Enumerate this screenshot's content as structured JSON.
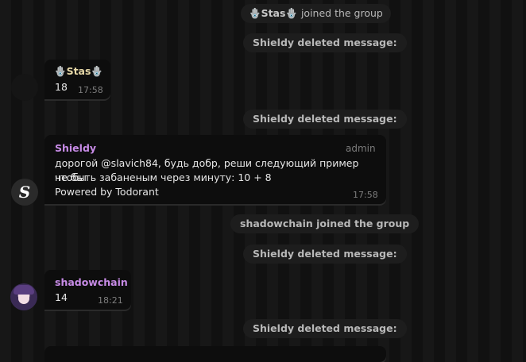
{
  "messages": {
    "service_1": {
      "sender": "🪬Stas🪬",
      "text": " joined the group"
    },
    "service_2": {
      "text": "Shieldy deleted message:"
    },
    "msg_stas": {
      "sender": "🪬Stas🪬",
      "body": "18",
      "time": "17:58"
    },
    "service_3": {
      "text": "Shieldy deleted message:"
    },
    "msg_shieldy": {
      "sender": "Shieldy",
      "role": "admin",
      "line1": "дорогой @slavich84, будь добр, реши следующий пример чтобы",
      "line2": "не быть забаненым через минуту: 10 + 8",
      "line3": "Powered by Todorant",
      "time": "17:58",
      "avatar_letter": "S"
    },
    "service_4": {
      "text": "shadowchain joined the group"
    },
    "service_5": {
      "text": "Shieldy deleted message:"
    },
    "msg_shadow": {
      "sender": "shadowchain",
      "body": "14",
      "time": "18:21"
    },
    "service_6": {
      "text": "Shieldy deleted message:"
    }
  },
  "colors": {
    "sender_name": "#c78be6",
    "bubble_bg": "#0d0d0d",
    "service_bg": "#1e1e1e"
  }
}
